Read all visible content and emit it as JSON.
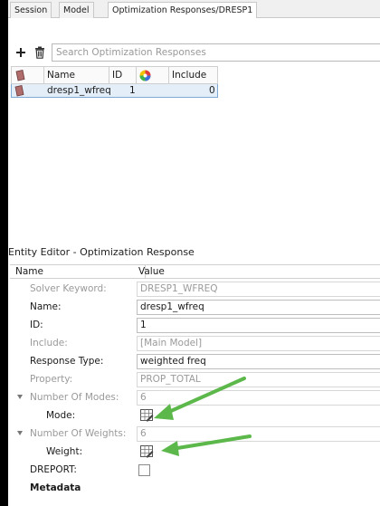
{
  "tabs": [
    {
      "label": "Session",
      "active": false
    },
    {
      "label": "Model",
      "active": false
    },
    {
      "label": "Optimization Responses/DRESP1",
      "active": true
    }
  ],
  "toolbar": {
    "add_icon": "plus-icon",
    "delete_icon": "trash-icon",
    "search_placeholder": "Search Optimization Responses"
  },
  "table": {
    "columns": [
      "",
      "Name",
      "ID",
      "color-wheel-icon",
      "Include"
    ],
    "rows": [
      {
        "icon": "response-icon",
        "name": "dresp1_wfreq",
        "id": "1",
        "include": "0",
        "selected": true
      }
    ]
  },
  "entity_editor": {
    "title": "Entity Editor - Optimization Response",
    "header_name": "Name",
    "header_value": "Value",
    "props": [
      {
        "label": "Solver Keyword:",
        "value": "DRESP1_WFREQ",
        "state": "disabled"
      },
      {
        "label": "Name:",
        "value": "dresp1_wfreq",
        "state": "field"
      },
      {
        "label": "ID:",
        "value": "1",
        "state": "field"
      },
      {
        "label": "Include:",
        "value": "[Main Model]",
        "state": "disabled"
      },
      {
        "label": "Response Type:",
        "value": "weighted freq",
        "state": "field"
      },
      {
        "label": "Property:",
        "value": "PROP_TOTAL",
        "state": "disabled"
      },
      {
        "label": "Number Of Modes:",
        "value": "6",
        "state": "disabled"
      },
      {
        "label": "Mode:",
        "value": "",
        "state": "table-icon"
      },
      {
        "label": "Number Of Weights:",
        "value": "6",
        "state": "disabled"
      },
      {
        "label": "Weight:",
        "value": "",
        "state": "table-icon"
      },
      {
        "label": "DREPORT:",
        "value": "",
        "state": "checkbox"
      },
      {
        "label": "Metadata",
        "value": "",
        "state": "section"
      }
    ]
  },
  "colors": {
    "selection_bg": "#e4eef8",
    "selection_border": "#7fa7d3",
    "annotation_arrow": "#5cb84a"
  }
}
